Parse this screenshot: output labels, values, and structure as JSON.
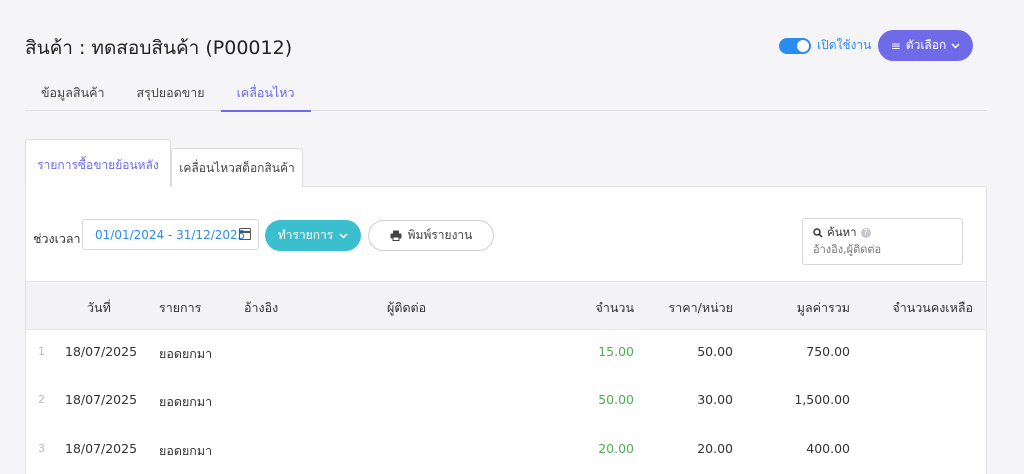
{
  "header": {
    "title": "สินค้า : ทดสอบสินค้า (P00012)",
    "toggle_label": "เปิดใช้งาน",
    "options_label": "ตัวเลือก"
  },
  "main_tabs": [
    {
      "label": "ข้อมูลสินค้า"
    },
    {
      "label": "สรุปยอดขาย"
    },
    {
      "label": "เคลื่อนไหว"
    }
  ],
  "sub_tabs": [
    {
      "label": "รายการซื้อขายย้อนหลัง"
    },
    {
      "label": "เคลื่อนไหวสต็อกสินค้า"
    }
  ],
  "filters": {
    "period_label": "ช่วงเวลา",
    "date_range": "01/01/2024 - 31/12/2025",
    "action_label": "ทำรายการ",
    "print_label": "พิมพ์รายงาน",
    "search_label": "ค้นหา",
    "search_placeholder": "อ้างอิง,ผู้ติดต่อ"
  },
  "table": {
    "headers": {
      "date": "วันที่",
      "item": "รายการ",
      "ref": "อ้างอิง",
      "contact": "ผู้ติดต่อ",
      "qty": "จำนวน",
      "unit_price": "ราคา/หน่วย",
      "total": "มูลค่ารวม",
      "remaining": "จำนวนคงเหลือ"
    },
    "rows": [
      {
        "idx": "1",
        "date": "18/07/2025",
        "item": "ยอดยกมา",
        "qty": "15.00",
        "unit_price": "50.00",
        "total": "750.00"
      },
      {
        "idx": "2",
        "date": "18/07/2025",
        "item": "ยอดยกมา",
        "qty": "50.00",
        "unit_price": "30.00",
        "total": "1,500.00"
      },
      {
        "idx": "3",
        "date": "18/07/2025",
        "item": "ยอดยกมา",
        "qty": "20.00",
        "unit_price": "20.00",
        "total": "400.00"
      }
    ]
  },
  "colors": {
    "accent": "#6e6ae8",
    "action": "#3bbfcf",
    "toggle": "#2b8cf0",
    "qty_green": "#4caf50"
  }
}
